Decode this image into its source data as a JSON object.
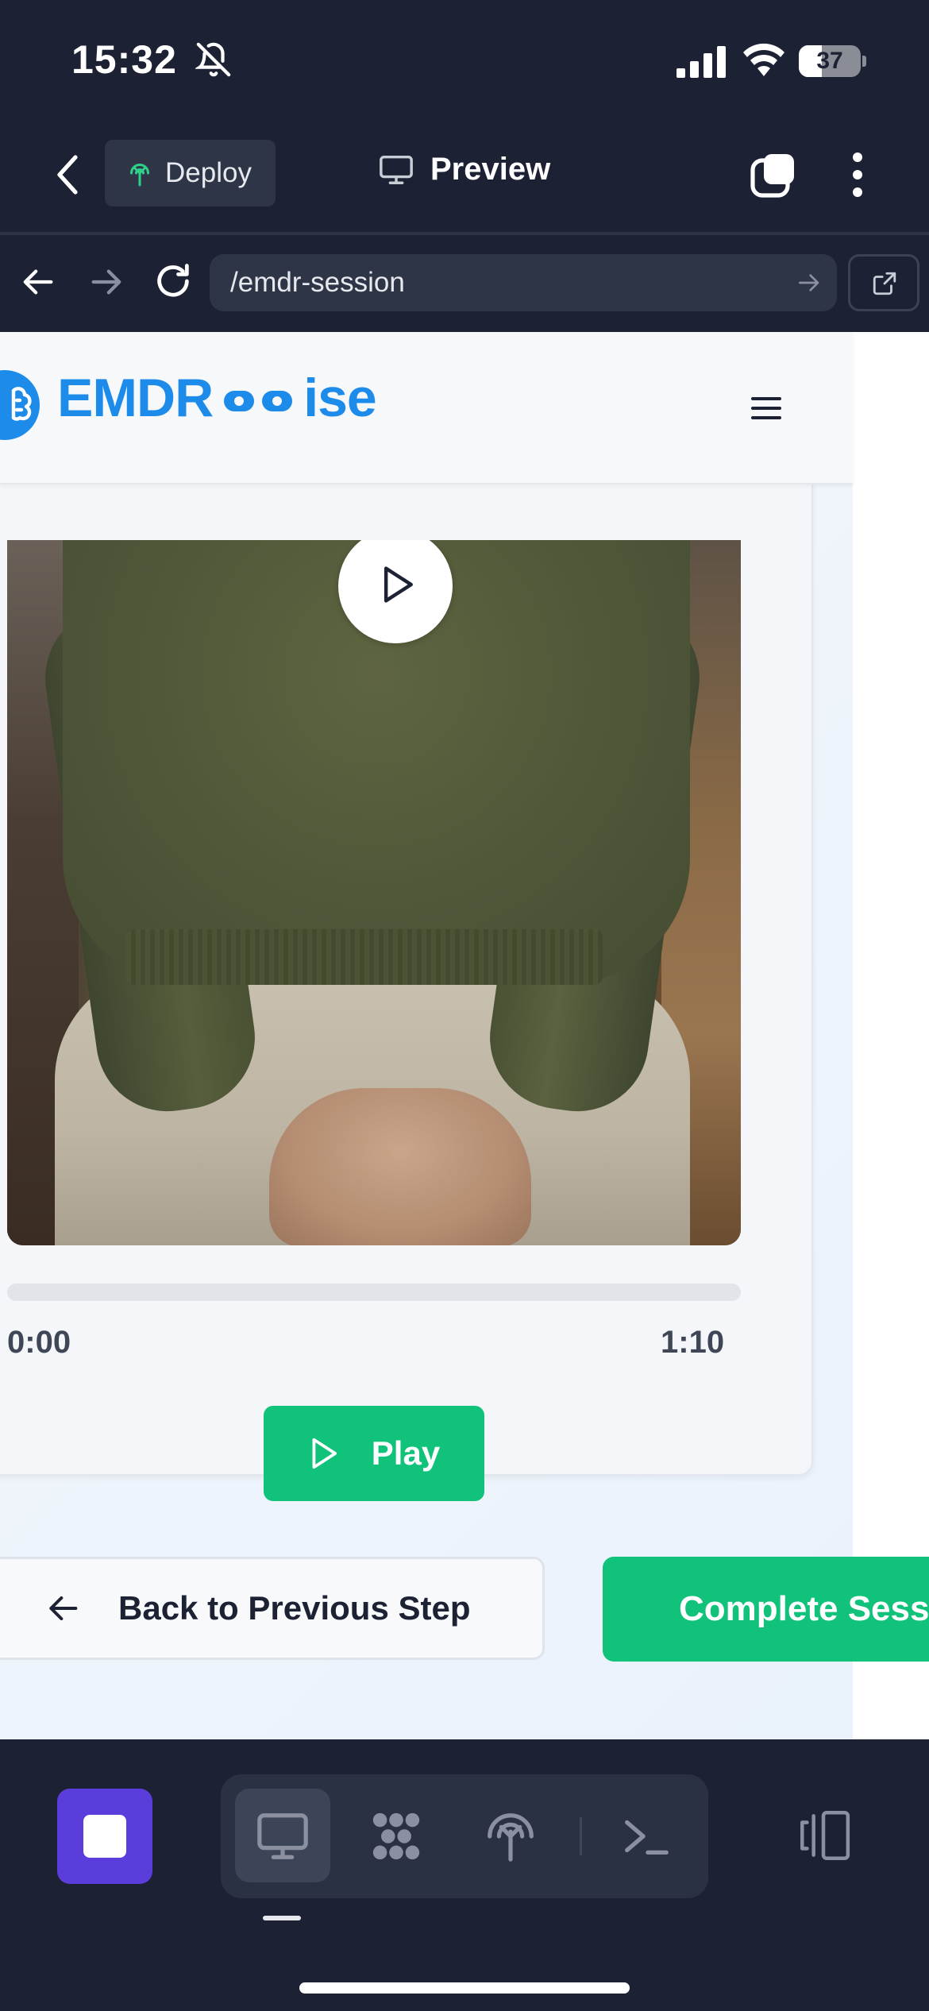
{
  "status_bar": {
    "time": "15:32",
    "battery": "37",
    "battery_level": 0.37
  },
  "app_bar": {
    "deploy_label": "Deploy",
    "preview_label": "Preview"
  },
  "browser": {
    "url": "/emdr-session"
  },
  "site": {
    "logo_left": "EMDR",
    "logo_right": "ise"
  },
  "player": {
    "current_time": "0:00",
    "total_time": "1:10",
    "progress": 0,
    "play_label": "Play"
  },
  "navigation": {
    "back_label": "Back to Previous Step",
    "complete_label": "Complete Session"
  },
  "colors": {
    "brand_blue": "#1d8bea",
    "accent_green": "#10c27a",
    "toolbar_purple": "#5b3ddc",
    "chrome_dark": "#1c2233"
  },
  "toolbar": {
    "items": [
      "preview-icon",
      "nodes-icon",
      "deploy-icon",
      "terminal-icon"
    ],
    "active_item": "preview-icon"
  }
}
